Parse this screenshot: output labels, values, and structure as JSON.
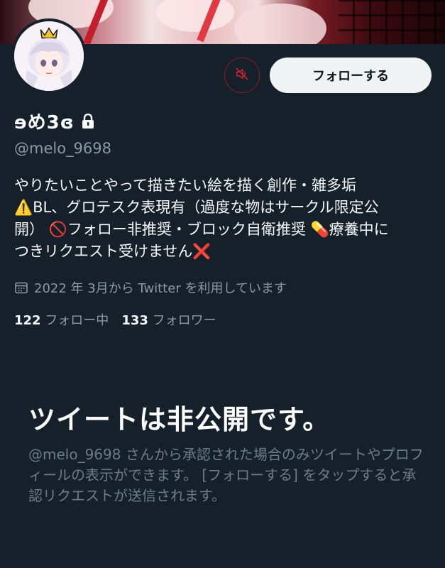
{
  "profile": {
    "display_name": "ɘめ3ɞ",
    "handle": "@melo_9698",
    "bio_lines": [
      "やりたいことやって描きたい絵を描く創作・雑多垢",
      "⚠️BL、グロテスク表現有（過度な物はサークル限定公",
      "開） 🚫フォロー非推奨・ブロック自衛推奨 💊療養中に",
      "つきリクエスト受けません❌"
    ],
    "joined": "2022 年 3月から Twitter を利用しています",
    "following_count": "122",
    "following_label": "フォロー中",
    "followers_count": "133",
    "followers_label": "フォロワー"
  },
  "actions": {
    "follow_label": "フォローする",
    "mute_icon": "muted-speaker-icon"
  },
  "private_notice": {
    "title": "ツイートは非公開です。",
    "body": "@melo_9698 さんから承認された場合のみツイートやプロフィールの表示ができます。 [フォローする] をタップすると承認リクエストが送信されます。"
  },
  "colors": {
    "background": "#15202b",
    "secondary_text": "#8b98a5",
    "muted_red": "#c0262c",
    "button_bg": "#eff3f4"
  }
}
